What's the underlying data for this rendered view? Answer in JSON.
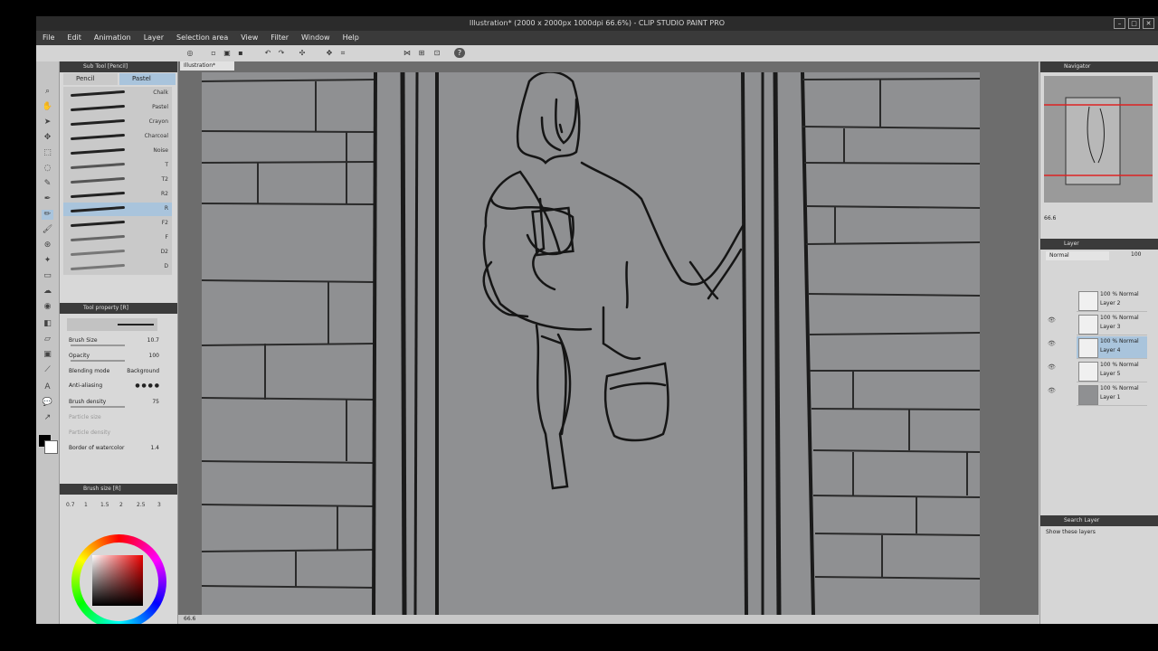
{
  "window": {
    "title": "Illustration* (2000 x 2000px 1000dpi 66.6%) - CLIP STUDIO PAINT PRO"
  },
  "menu": [
    "File",
    "Edit",
    "Animation",
    "Layer",
    "Selection area",
    "View",
    "Filter",
    "Window",
    "Help"
  ],
  "sub_tool": {
    "header": "Sub Tool [Pencil]",
    "tabs": [
      "Pencil",
      "Pastel"
    ],
    "active_tab": "Pastel",
    "brushes": [
      {
        "label": "Chalk",
        "selected": false
      },
      {
        "label": "Pastel",
        "selected": false
      },
      {
        "label": "Crayon",
        "selected": false
      },
      {
        "label": "Charcoal",
        "selected": false
      },
      {
        "label": "Noise",
        "selected": false
      },
      {
        "label": "T",
        "selected": false
      },
      {
        "label": "T2",
        "selected": false
      },
      {
        "label": "R2",
        "selected": false
      },
      {
        "label": "R",
        "selected": true
      },
      {
        "label": "F2",
        "selected": false
      },
      {
        "label": "F",
        "selected": false
      },
      {
        "label": "D2",
        "selected": false
      },
      {
        "label": "D",
        "selected": false
      }
    ]
  },
  "tool_property": {
    "header": "Tool property [R]",
    "brush_size_label": "Brush Size",
    "brush_size": "10.7",
    "opacity_label": "Opacity",
    "opacity": "100",
    "blending_label": "Blending mode",
    "blending": "Background",
    "antialias_label": "Anti-aliasing",
    "density_label": "Brush density",
    "density": "75",
    "particle_size_label": "Particle size",
    "particle_density_label": "Particle density",
    "watercolor_label": "Border of watercolor",
    "watercolor": "1.4"
  },
  "brush_size_panel": {
    "header": "Brush size [R]",
    "sizes": [
      "0.7",
      "1",
      "1.5",
      "2",
      "2.5",
      "3"
    ]
  },
  "canvas": {
    "tab": "Illustration*",
    "zoom": "66.6"
  },
  "navigator": {
    "header": "Navigator",
    "zoom": "66.6"
  },
  "layers": {
    "header": "Layer",
    "blend": "Normal",
    "opacity": "100",
    "items": [
      {
        "mode": "100 % Normal",
        "name": "Layer 2",
        "selected": false
      },
      {
        "mode": "100 % Normal",
        "name": "Layer 3",
        "selected": false
      },
      {
        "mode": "100 % Normal",
        "name": "Layer 4",
        "selected": true
      },
      {
        "mode": "100 % Normal",
        "name": "Layer 5",
        "selected": false
      },
      {
        "mode": "100 % Normal",
        "name": "Layer 1",
        "selected": false
      }
    ]
  },
  "search_layer": {
    "header": "Search Layer",
    "option": "Show these layers"
  },
  "colors": {
    "titlebar": "#2b2b2b",
    "menubar": "#3a3a3a",
    "selection": "#a9c4dc",
    "canvas_bg": "#8f9092"
  }
}
